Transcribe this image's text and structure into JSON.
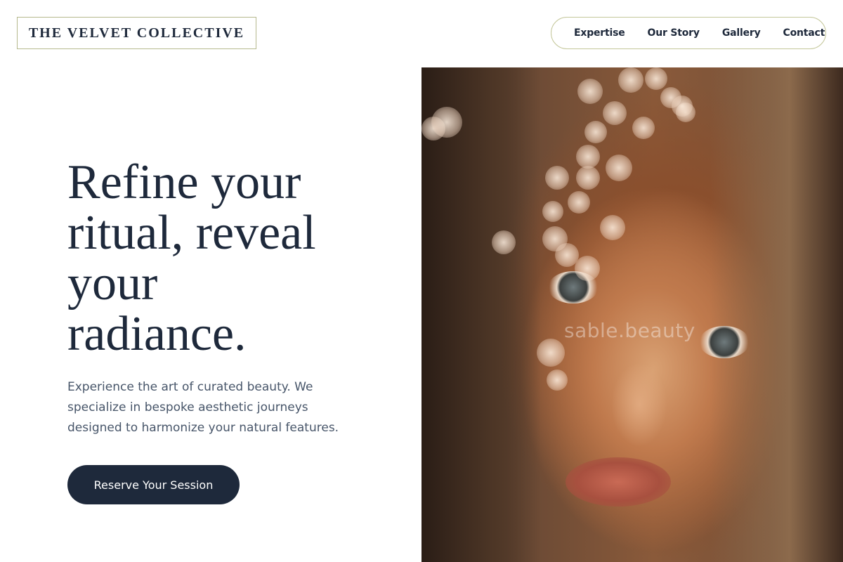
{
  "header": {
    "logo_text": "THE VELVET COLLECTIVE",
    "nav": [
      {
        "label": "Expertise"
      },
      {
        "label": "Our Story"
      },
      {
        "label": "Gallery"
      },
      {
        "label": "Contact"
      }
    ]
  },
  "hero": {
    "headline_lines": [
      "Refine your",
      "ritual, reveal",
      "your",
      "radiance."
    ],
    "description": "Experience the art of curated beauty. We specialize in bespoke aesthetic journeys designed to harmonize your natural features.",
    "cta_label": "Reserve Your Session"
  },
  "image": {
    "watermark": "sable.beauty"
  },
  "colors": {
    "primary": "#1e293b",
    "text_muted": "#475569",
    "accent_border": "#b6b98e",
    "background": "#ffffff"
  }
}
